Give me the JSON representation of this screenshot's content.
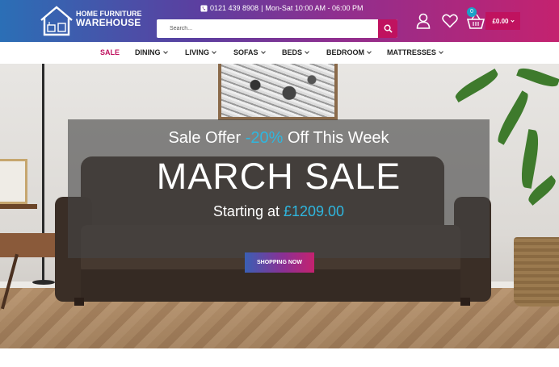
{
  "brand": {
    "line1": "HOME FURNITURE",
    "line2": "WAREHOUSE"
  },
  "topbar": {
    "phone": "0121 439 8908",
    "separator": "|",
    "hours": "Mon-Sat 10:00 AM - 06:00 PM"
  },
  "search": {
    "placeholder": "Search..."
  },
  "cart": {
    "count": "0",
    "total": "£0.00"
  },
  "nav": {
    "items": [
      {
        "label": "SALE",
        "has_dropdown": false
      },
      {
        "label": "DINING",
        "has_dropdown": true
      },
      {
        "label": "LIVING",
        "has_dropdown": true
      },
      {
        "label": "SOFAS",
        "has_dropdown": true
      },
      {
        "label": "BEDS",
        "has_dropdown": true
      },
      {
        "label": "BEDROOM",
        "has_dropdown": true
      },
      {
        "label": "MATTRESSES",
        "has_dropdown": true
      }
    ]
  },
  "hero": {
    "offer_prefix": "Sale Offer",
    "offer_pct": "-20%",
    "offer_suffix": "Off This Week",
    "title": "MARCH SALE",
    "price_prefix": "Starting at",
    "price": "£1209.00",
    "cta": "SHOPPING NOW"
  },
  "colors": {
    "accent_pink": "#c0125f",
    "accent_cyan": "#2fb6de",
    "header_gradient_start": "#2b6fb6",
    "header_gradient_end": "#c4226f"
  }
}
